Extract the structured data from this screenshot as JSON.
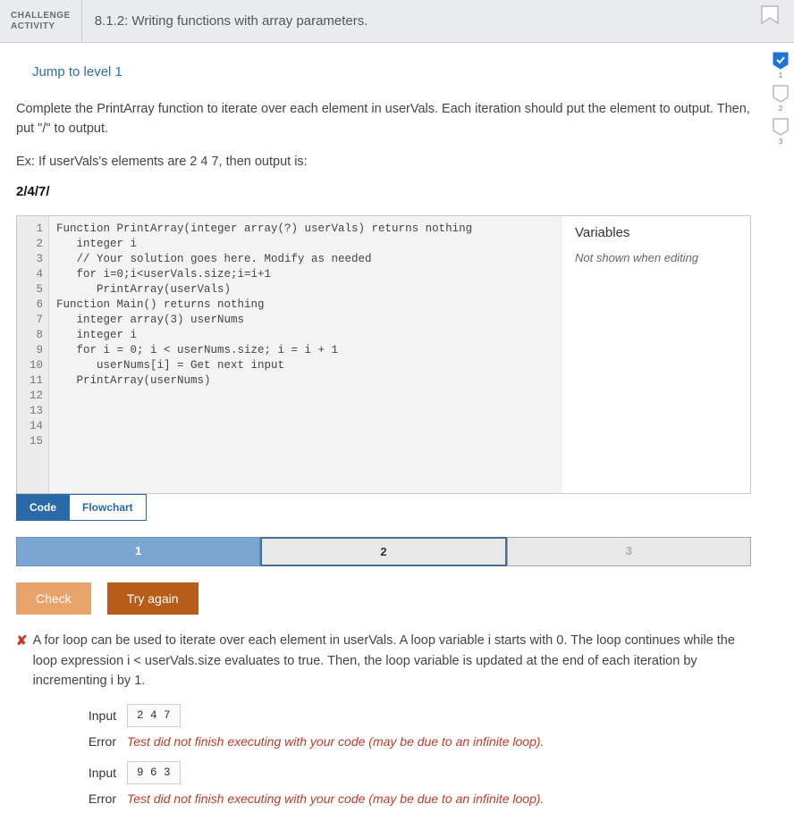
{
  "header": {
    "label_line1": "CHALLENGE",
    "label_line2": "ACTIVITY",
    "title": "8.1.2: Writing functions with array parameters."
  },
  "side": {
    "items": [
      {
        "num": "1",
        "checked": true
      },
      {
        "num": "2",
        "checked": false
      },
      {
        "num": "3",
        "checked": false
      }
    ]
  },
  "jump_link": "Jump to level 1",
  "instructions": {
    "p1": "Complete the PrintArray function to iterate over each element in userVals. Each iteration should put the element to output. Then, put \"/\" to output.",
    "p2": "Ex: If userVals's elements are 2 4 7, then output is:",
    "example": "2/4/7/"
  },
  "editor": {
    "line_numbers": [
      "1",
      "2",
      "3",
      "4",
      "5",
      "6",
      "7",
      "8",
      "9",
      "10",
      "11",
      "12",
      "13",
      "14",
      "15"
    ],
    "lines": [
      "Function PrintArray(integer array(?) userVals) returns nothing",
      "   integer i",
      "",
      "   // Your solution goes here. Modify as needed",
      "   for i=0;i<userVals.size;i=i+1",
      "      PrintArray(userVals)",
      "",
      "Function Main() returns nothing",
      "   integer array(3) userNums",
      "   integer i",
      "",
      "   for i = 0; i < userNums.size; i = i + 1",
      "      userNums[i] = Get next input",
      "",
      "   PrintArray(userNums)"
    ],
    "vars_title": "Variables",
    "vars_msg": "Not shown when editing",
    "tabs": {
      "code": "Code",
      "flowchart": "Flowchart"
    }
  },
  "steps": {
    "s1": "1",
    "s2": "2",
    "s3": "3"
  },
  "buttons": {
    "check": "Check",
    "try_again": "Try again"
  },
  "feedback": {
    "x": "✘",
    "text": "A for loop can be used to iterate over each element in userVals. A loop variable i starts with 0. The loop continues while the loop expression i < userVals.size evaluates to true. Then, the loop variable is updated at the end of each iteration by incrementing i by 1."
  },
  "io": {
    "input_label": "Input",
    "error_label": "Error",
    "runs": [
      {
        "input": "2 4 7",
        "error": "Test did not finish executing with your code (may be due to an infinite loop)."
      },
      {
        "input": "9 6 3",
        "error": "Test did not finish executing with your code (may be due to an infinite loop)."
      }
    ]
  },
  "colors": {
    "accent_blue": "#2b6aa8",
    "step_done": "#7ca6d2",
    "btn_check": "#e8a36a",
    "btn_try": "#b85c1a",
    "error_red": "#c0392b"
  }
}
